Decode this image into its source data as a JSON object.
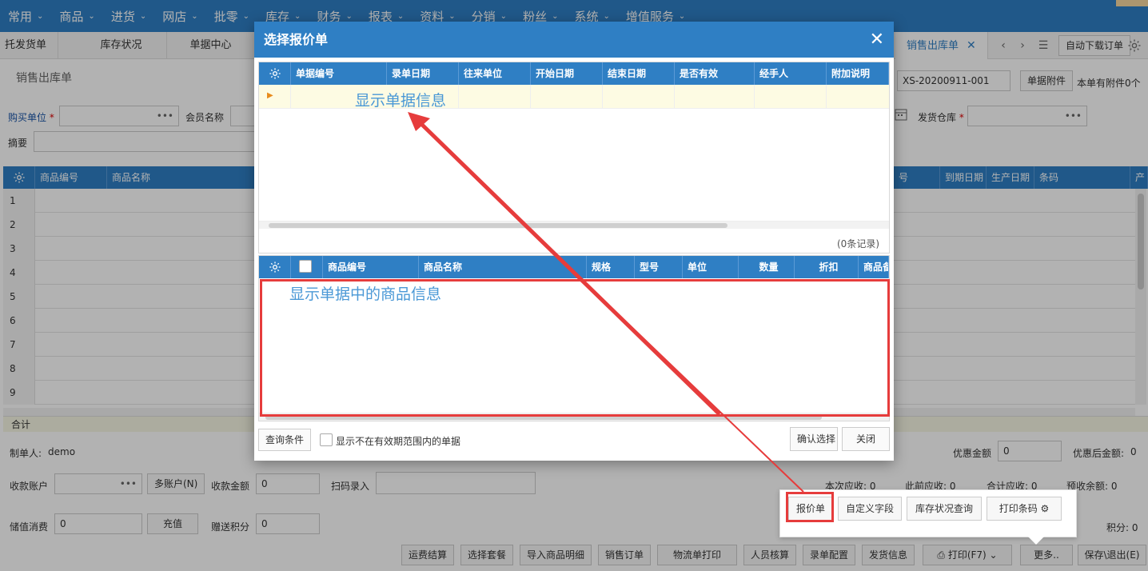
{
  "menu": [
    {
      "label": "常用"
    },
    {
      "label": "商品"
    },
    {
      "label": "进货"
    },
    {
      "label": "网店"
    },
    {
      "label": "批零"
    },
    {
      "label": "库存"
    },
    {
      "label": "财务"
    },
    {
      "label": "报表"
    },
    {
      "label": "资料"
    },
    {
      "label": "分销"
    },
    {
      "label": "粉丝"
    },
    {
      "label": "系统"
    },
    {
      "label": "增值服务"
    }
  ],
  "tabs": {
    "items": [
      "托发货单",
      "库存状况",
      "单据中心"
    ],
    "active": "销售出库单",
    "auto_download": "自动下载订单"
  },
  "form": {
    "page_title": "销售出库单",
    "bill_no": "XS-20200911-001",
    "attachment_btn": "单据附件",
    "attachment_count": "本单有附件0个",
    "buyer_label": "购买单位",
    "member_label": "会员名称",
    "warehouse_label": "发货仓库",
    "summary_label": "摘要"
  },
  "grid": {
    "columns": [
      "商品编号",
      "商品名称"
    ],
    "right_columns": [
      "号",
      "到期日期",
      "生产日期",
      "条码",
      "产"
    ],
    "rows": [
      "1",
      "2",
      "3",
      "4",
      "5",
      "6",
      "7",
      "8",
      "9"
    ],
    "total_label": "合计"
  },
  "footer": {
    "maker_label": "制单人:",
    "maker_value": "demo",
    "account_label": "收款账户",
    "multi_account": "多账户(N)",
    "receive_amount_label": "收款金额",
    "receive_amount": "0",
    "scan_label": "扫码录入",
    "stored_label": "储值消费",
    "stored_value": "0",
    "recharge": "充值",
    "points_label": "赠送积分",
    "points_value": "0",
    "discount_label": "优惠金额",
    "discount_value": "0",
    "after_discount": "优惠后金额:",
    "after_discount_value": "0",
    "current_due": "本次应收:",
    "current_due_value": "0",
    "prev_due": "此前应收:",
    "prev_due_value": "0",
    "total_due": "合计应收:",
    "total_due_value": "0",
    "prepay": "预收余额:",
    "prepay_value": "0",
    "score": "积分:",
    "score_value": "0"
  },
  "bottom_buttons": [
    "运费结算",
    "选择套餐",
    "导入商品明细",
    "销售订单",
    "物流单打印",
    "人员核算",
    "录单配置",
    "发货信息",
    "打印(F7)",
    "更多..",
    "保存\\退出(E)"
  ],
  "popup": {
    "buttons": [
      "报价单",
      "自定义字段",
      "库存状况查询",
      "打印条码"
    ]
  },
  "modal": {
    "title": "选择报价单",
    "top_columns": [
      "单据编号",
      "录单日期",
      "往来单位",
      "开始日期",
      "结束日期",
      "是否有效",
      "经手人",
      "附加说明"
    ],
    "record_count": "(0条记录)",
    "bottom_columns": [
      "商品编号",
      "商品名称",
      "规格",
      "型号",
      "单位",
      "数量",
      "折扣",
      "商品备"
    ],
    "annotation_top": "显示单据信息",
    "annotation_bottom": "显示单据中的商品信息",
    "query_btn": "查询条件",
    "show_expired": "显示不在有效期范围内的单据",
    "confirm_btn": "确认选择",
    "close_btn": "关闭"
  },
  "colors": {
    "primary": "#2f7fc4",
    "annotation": "#4a98d6",
    "highlight": "#e63c3c",
    "row_highlight": "#fdfbe3"
  }
}
